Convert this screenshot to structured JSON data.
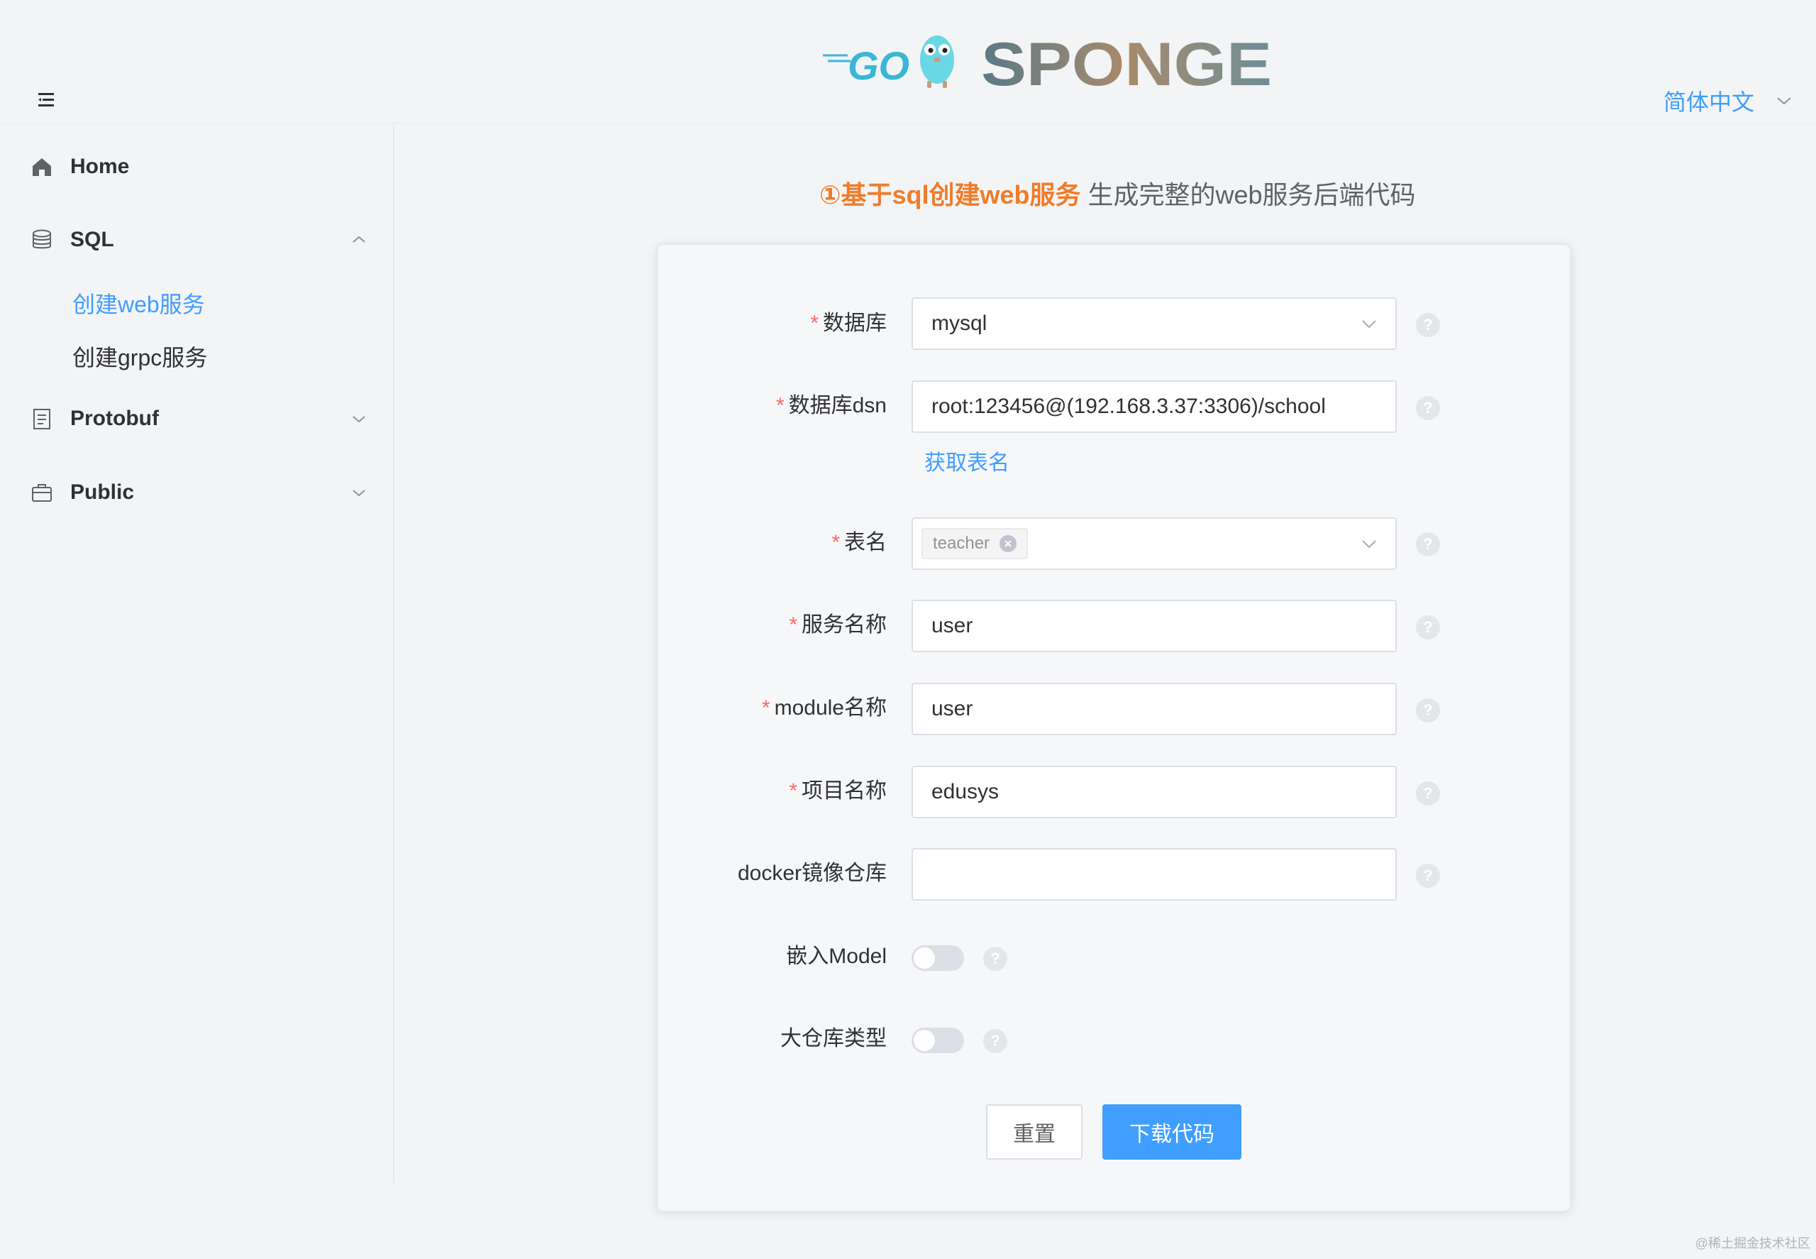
{
  "header": {
    "logo_text": "SPONGE",
    "logo_go_text": "GO",
    "language": "简体中文"
  },
  "sidebar": {
    "items": [
      {
        "label": "Home",
        "icon": "home-icon"
      },
      {
        "label": "SQL",
        "icon": "database-icon",
        "expanded": true,
        "children": [
          {
            "label": "创建web服务",
            "active": true
          },
          {
            "label": "创建grpc服务",
            "active": false
          }
        ]
      },
      {
        "label": "Protobuf",
        "icon": "document-icon",
        "expanded": false
      },
      {
        "label": "Public",
        "icon": "briefcase-icon",
        "expanded": false
      }
    ]
  },
  "page": {
    "title_emphasis": "①基于sql创建web服务",
    "title_rest": " 生成完整的web服务后端代码"
  },
  "form": {
    "database": {
      "label": "数据库",
      "required": true,
      "value": "mysql"
    },
    "dsn": {
      "label": "数据库dsn",
      "required": true,
      "value": "root:123456@(192.168.3.37:3306)/school"
    },
    "fetch_tables_label": "获取表名",
    "tables": {
      "label": "表名",
      "required": true,
      "tags": [
        "teacher"
      ]
    },
    "service_name": {
      "label": "服务名称",
      "required": true,
      "value": "user"
    },
    "module_name": {
      "label": "module名称",
      "required": true,
      "value": "user"
    },
    "project_name": {
      "label": "项目名称",
      "required": true,
      "value": "edusys"
    },
    "docker_repo": {
      "label": "docker镜像仓库",
      "required": false,
      "value": ""
    },
    "embed_model": {
      "label": "嵌入Model",
      "on": false
    },
    "large_repo": {
      "label": "大仓库类型",
      "on": false
    },
    "reset_label": "重置",
    "download_label": "下载代码"
  },
  "watermark": "@稀土掘金技术社区",
  "colors": {
    "accent": "#409eff",
    "title_accent": "#f07c29",
    "required_mark": "#f56c6c"
  }
}
